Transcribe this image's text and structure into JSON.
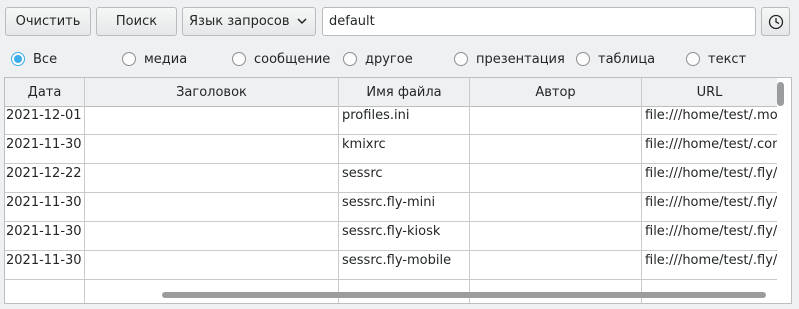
{
  "toolbar": {
    "clear_label": "Очистить",
    "search_label": "Поиск",
    "query_language": "Язык запросов",
    "query_value": "default"
  },
  "filters": [
    {
      "label": "Все",
      "selected": true
    },
    {
      "label": "медиа",
      "selected": false
    },
    {
      "label": "сообщение",
      "selected": false
    },
    {
      "label": "другое",
      "selected": false
    },
    {
      "label": "презентация",
      "selected": false
    },
    {
      "label": "таблица",
      "selected": false
    },
    {
      "label": "текст",
      "selected": false
    }
  ],
  "table": {
    "columns": [
      "Дата",
      "Заголовок",
      "Имя файла",
      "Автор",
      "URL"
    ],
    "rows": [
      {
        "date": "2021-12-01",
        "title": "",
        "filename": "profiles.ini",
        "author": "",
        "url": "file:///home/test/.mozilla/firefox/profiles.ini"
      },
      {
        "date": "2021-11-30",
        "title": "",
        "filename": "kmixrc",
        "author": "",
        "url": "file:///home/test/.config/kmixrc"
      },
      {
        "date": "2021-12-22",
        "title": "",
        "filename": "sessrc",
        "author": "",
        "url": "file:///home/test/.fly/sessrc"
      },
      {
        "date": "2021-11-30",
        "title": "",
        "filename": "sessrc.fly-mini",
        "author": "",
        "url": "file:///home/test/.fly/sessrc.fly-mini"
      },
      {
        "date": "2021-11-30",
        "title": "",
        "filename": "sessrc.fly-kiosk",
        "author": "",
        "url": "file:///home/test/.fly/sessrc.fly-kiosk"
      },
      {
        "date": "2021-11-30",
        "title": "",
        "filename": "sessrc.fly-mobile",
        "author": "",
        "url": "file:///home/test/.fly/sessrc.fly-mobile"
      }
    ]
  },
  "icons": {
    "history": "clock-icon",
    "dropdown": "chevron-down-icon"
  },
  "colors": {
    "accent": "#3daee9",
    "window": "#eff0f1"
  }
}
